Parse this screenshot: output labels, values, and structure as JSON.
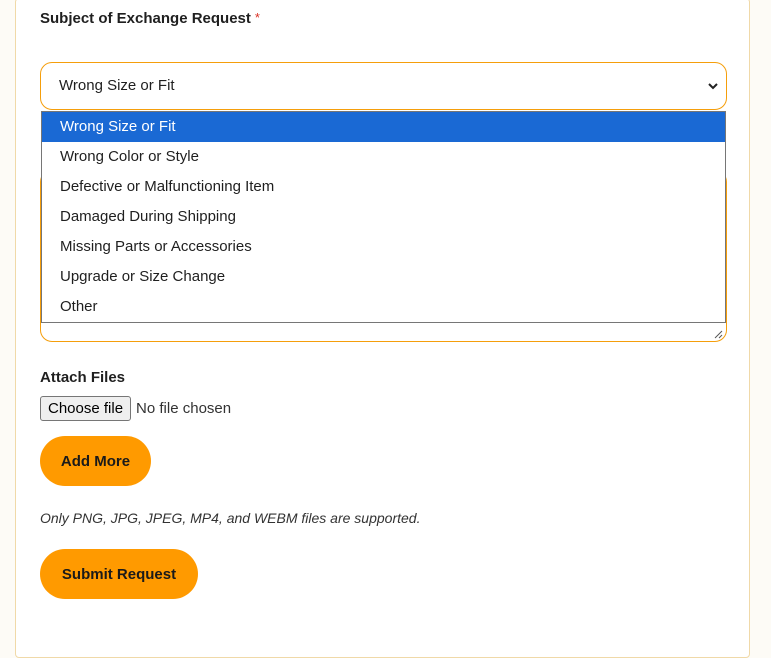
{
  "subject": {
    "label": "Subject of Exchange Request",
    "required_mark": "*",
    "selected_value": "Wrong Size or Fit",
    "options": [
      "Wrong Size or Fit",
      "Wrong Color or Style",
      "Defective or Malfunctioning Item",
      "Damaged During Shipping",
      "Missing Parts or Accessories",
      "Upgrade or Size Change",
      "Other"
    ]
  },
  "attach": {
    "label": "Attach Files",
    "choose_label": "Choose file",
    "status": "No file chosen",
    "add_more_label": "Add More",
    "note": "Only PNG, JPG, JPEG, MP4, and WEBM files are supported."
  },
  "submit_label": "Submit Request",
  "colors": {
    "accent": "#ff9a00",
    "border_accent": "#f59e0b",
    "selected_option": "#1a69d4",
    "required": "#d93025"
  }
}
